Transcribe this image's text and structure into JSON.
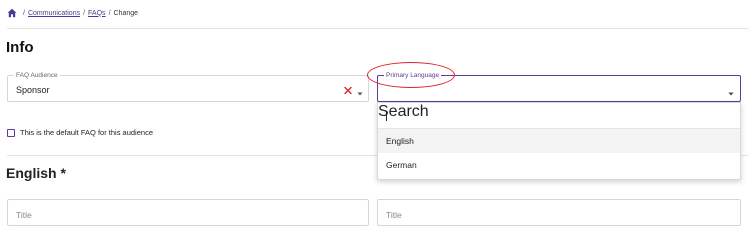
{
  "breadcrumb": {
    "items": [
      "Communications",
      "FAQs"
    ],
    "separator": "/",
    "current": "Change"
  },
  "page": {
    "title": "Info"
  },
  "audience": {
    "label": "FAQ Audience",
    "value": "Sponsor"
  },
  "language": {
    "label": "Primary Language",
    "value": ""
  },
  "language_dropdown": {
    "search_placeholder": "Search",
    "options": [
      "English",
      "German"
    ],
    "hovered_option": "English"
  },
  "default_checkbox": {
    "label": "This is the default FAQ for this audience",
    "checked": false
  },
  "section": {
    "title": "English *"
  },
  "title_fields": {
    "left_placeholder": "Title",
    "right_placeholder": "Title"
  },
  "colors": {
    "accent": "#5a3d94",
    "clear_icon": "#d9262c",
    "highlight": "#d9262c"
  }
}
